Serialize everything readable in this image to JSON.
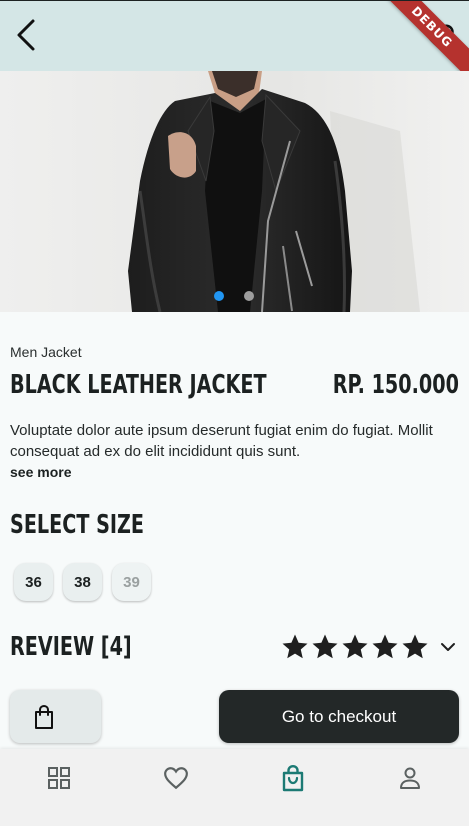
{
  "app_bar": {
    "back_icon": "arrow-back-icon",
    "favorite_icon": "heart-outline-icon",
    "debug_banner": "DEBUG"
  },
  "carousel": {
    "image": "man-in-black-leather-jacket",
    "total_slides": 2,
    "active_slide": 1,
    "active_color": "#2196f3",
    "inactive_color": "#9e9e9e"
  },
  "product": {
    "category": "Men Jacket",
    "name": "Black Leather Jacket",
    "price": "RP. 150.000",
    "description": "Voluptate dolor aute ipsum deserunt fugiat enim do fugiat. Mollit consequat ad ex do elit incididunt quis sunt.",
    "see_more": "see more"
  },
  "size_section": {
    "title": "Select Size",
    "sizes": [
      {
        "label": "36",
        "available": true
      },
      {
        "label": "38",
        "available": true
      },
      {
        "label": "39",
        "available": false
      }
    ]
  },
  "review_section": {
    "title": "Review [4]",
    "stars": 5,
    "expand_icon": "chevron-down-icon"
  },
  "actions": {
    "cart_icon": "shopping-bag-icon",
    "checkout_label": "Go to checkout"
  },
  "bottom_nav": {
    "items": [
      {
        "icon": "grid-icon",
        "active": false
      },
      {
        "icon": "heart-icon",
        "active": false
      },
      {
        "icon": "shopping-bag-icon",
        "active": true
      },
      {
        "icon": "person-icon",
        "active": false
      }
    ],
    "active_color": "#1c7a74",
    "inactive_color": "#5b6161"
  },
  "colors": {
    "app_bar_bg": "#d4e6e6",
    "page_bg": "#f7fafa",
    "checkout_bg": "#232828",
    "debug_banner": "#b5322e"
  }
}
